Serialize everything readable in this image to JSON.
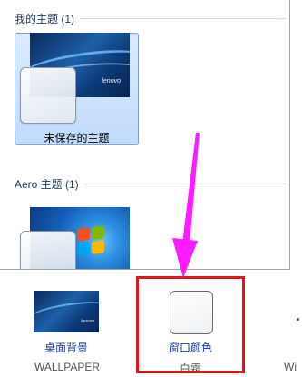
{
  "gallery": {
    "section_my_themes": "我的主题 (1)",
    "section_aero": "Aero 主题 (1)",
    "unsaved_theme": {
      "label": "未保存的主题",
      "wallpaper_brand": "lenovo"
    },
    "aero_theme": {}
  },
  "toolbar": {
    "background": {
      "label": "桌面背景",
      "sub": "WALLPAPER",
      "brand": "lenovo"
    },
    "window_color": {
      "label": "窗口颜色",
      "sub": "白霜"
    },
    "sound": {
      "label": "Wi"
    }
  },
  "colors": {
    "annotation_red": "#e0161c",
    "annotation_magenta": "#ff1aff",
    "link_blue": "#1c3f94",
    "selection": "#c1dbfc"
  }
}
